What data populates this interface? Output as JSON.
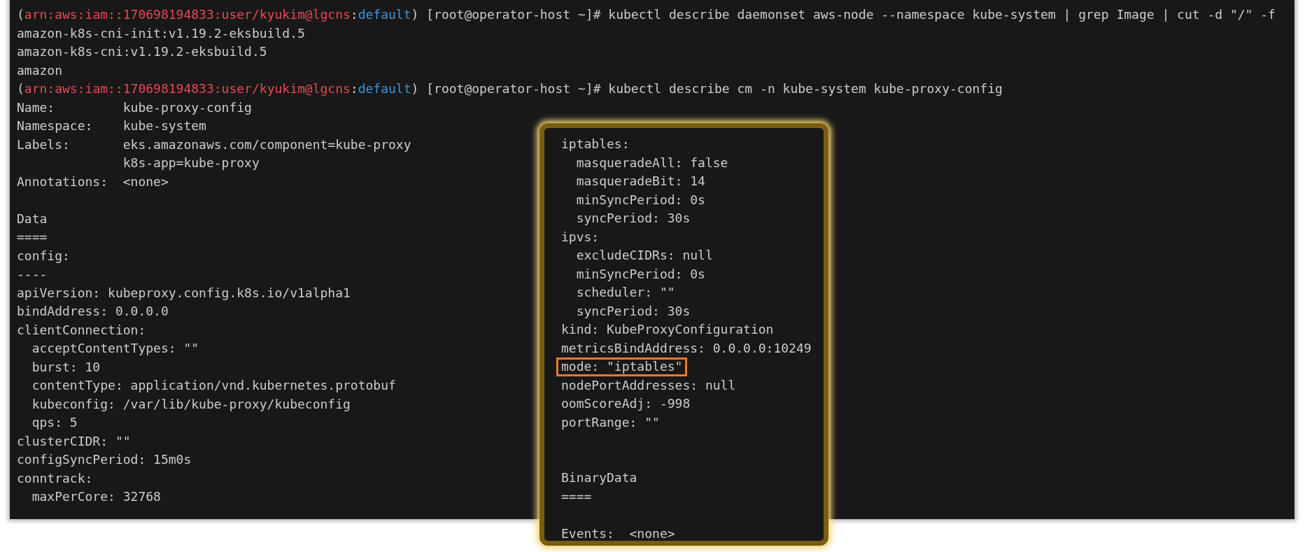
{
  "main_terminal": {
    "lines": [
      {
        "kind": "prompt",
        "segments": [
          {
            "text": "(",
            "color": "#cccccc"
          },
          {
            "text": "arn:aws:iam::170698194833:user/kyukim@lgcns",
            "color": "#e74856"
          },
          {
            "text": ":",
            "color": "#cccccc"
          },
          {
            "text": "default",
            "color": "#3a96dd"
          },
          {
            "text": ") [root@operator-host ~]# kubectl describe daemonset aws-node --namespace kube-system | grep Image | cut -d \"/\" -f",
            "color": "#cccccc"
          }
        ]
      },
      {
        "kind": "text",
        "text": "amazon-k8s-cni-init:v1.19.2-eksbuild.5"
      },
      {
        "kind": "text",
        "text": "amazon-k8s-cni:v1.19.2-eksbuild.5"
      },
      {
        "kind": "text",
        "text": "amazon"
      },
      {
        "kind": "prompt",
        "segments": [
          {
            "text": "(",
            "color": "#cccccc"
          },
          {
            "text": "arn:aws:iam::170698194833:user/kyukim@lgcns",
            "color": "#e74856"
          },
          {
            "text": ":",
            "color": "#cccccc"
          },
          {
            "text": "default",
            "color": "#3a96dd"
          },
          {
            "text": ") [root@operator-host ~]# kubectl describe cm -n kube-system kube-proxy-config",
            "color": "#cccccc"
          }
        ]
      },
      {
        "kind": "text",
        "text": "Name:         kube-proxy-config"
      },
      {
        "kind": "text",
        "text": "Namespace:    kube-system"
      },
      {
        "kind": "text",
        "text": "Labels:       eks.amazonaws.com/component=kube-proxy"
      },
      {
        "kind": "text",
        "text": "              k8s-app=kube-proxy"
      },
      {
        "kind": "text",
        "text": "Annotations:  <none>"
      },
      {
        "kind": "blank"
      },
      {
        "kind": "text",
        "text": "Data"
      },
      {
        "kind": "text",
        "text": "===="
      },
      {
        "kind": "text",
        "text": "config:"
      },
      {
        "kind": "text",
        "text": "----"
      },
      {
        "kind": "text",
        "text": "apiVersion: kubeproxy.config.k8s.io/v1alpha1"
      },
      {
        "kind": "text",
        "text": "bindAddress: 0.0.0.0"
      },
      {
        "kind": "text",
        "text": "clientConnection:"
      },
      {
        "kind": "text",
        "text": "  acceptContentTypes: \"\""
      },
      {
        "kind": "text",
        "text": "  burst: 10"
      },
      {
        "kind": "text",
        "text": "  contentType: application/vnd.kubernetes.protobuf"
      },
      {
        "kind": "text",
        "text": "  kubeconfig: /var/lib/kube-proxy/kubeconfig"
      },
      {
        "kind": "text",
        "text": "  qps: 5"
      },
      {
        "kind": "text",
        "text": "clusterCIDR: \"\""
      },
      {
        "kind": "text",
        "text": "configSyncPeriod: 15m0s"
      },
      {
        "kind": "text",
        "text": "conntrack:"
      },
      {
        "kind": "text",
        "text": "  maxPerCore: 32768"
      }
    ]
  },
  "inset_terminal": {
    "lines": [
      {
        "kind": "text",
        "text": "iptables:",
        "highlighted": false
      },
      {
        "kind": "text",
        "text": "  masqueradeAll: false",
        "highlighted": false
      },
      {
        "kind": "text",
        "text": "  masqueradeBit: 14",
        "highlighted": false
      },
      {
        "kind": "text",
        "text": "  minSyncPeriod: 0s",
        "highlighted": false
      },
      {
        "kind": "text",
        "text": "  syncPeriod: 30s",
        "highlighted": false
      },
      {
        "kind": "text",
        "text": "ipvs:",
        "highlighted": false
      },
      {
        "kind": "text",
        "text": "  excludeCIDRs: null",
        "highlighted": false
      },
      {
        "kind": "text",
        "text": "  minSyncPeriod: 0s",
        "highlighted": false
      },
      {
        "kind": "text",
        "text": "  scheduler: \"\"",
        "highlighted": false
      },
      {
        "kind": "text",
        "text": "  syncPeriod: 30s",
        "highlighted": false
      },
      {
        "kind": "text",
        "text": "kind: KubeProxyConfiguration",
        "highlighted": false
      },
      {
        "kind": "text",
        "text": "metricsBindAddress: 0.0.0.0:10249",
        "highlighted": false
      },
      {
        "kind": "text",
        "text": "mode: \"iptables\"",
        "highlighted": true
      },
      {
        "kind": "text",
        "text": "nodePortAddresses: null",
        "highlighted": false
      },
      {
        "kind": "text",
        "text": "oomScoreAdj: -998",
        "highlighted": false
      },
      {
        "kind": "text",
        "text": "portRange: \"\"",
        "highlighted": false
      },
      {
        "kind": "blank"
      },
      {
        "kind": "blank"
      },
      {
        "kind": "text",
        "text": "BinaryData",
        "highlighted": false
      },
      {
        "kind": "text",
        "text": "====",
        "highlighted": false
      },
      {
        "kind": "blank"
      },
      {
        "kind": "text",
        "text": "Events:  <none>",
        "highlighted": false
      }
    ]
  }
}
